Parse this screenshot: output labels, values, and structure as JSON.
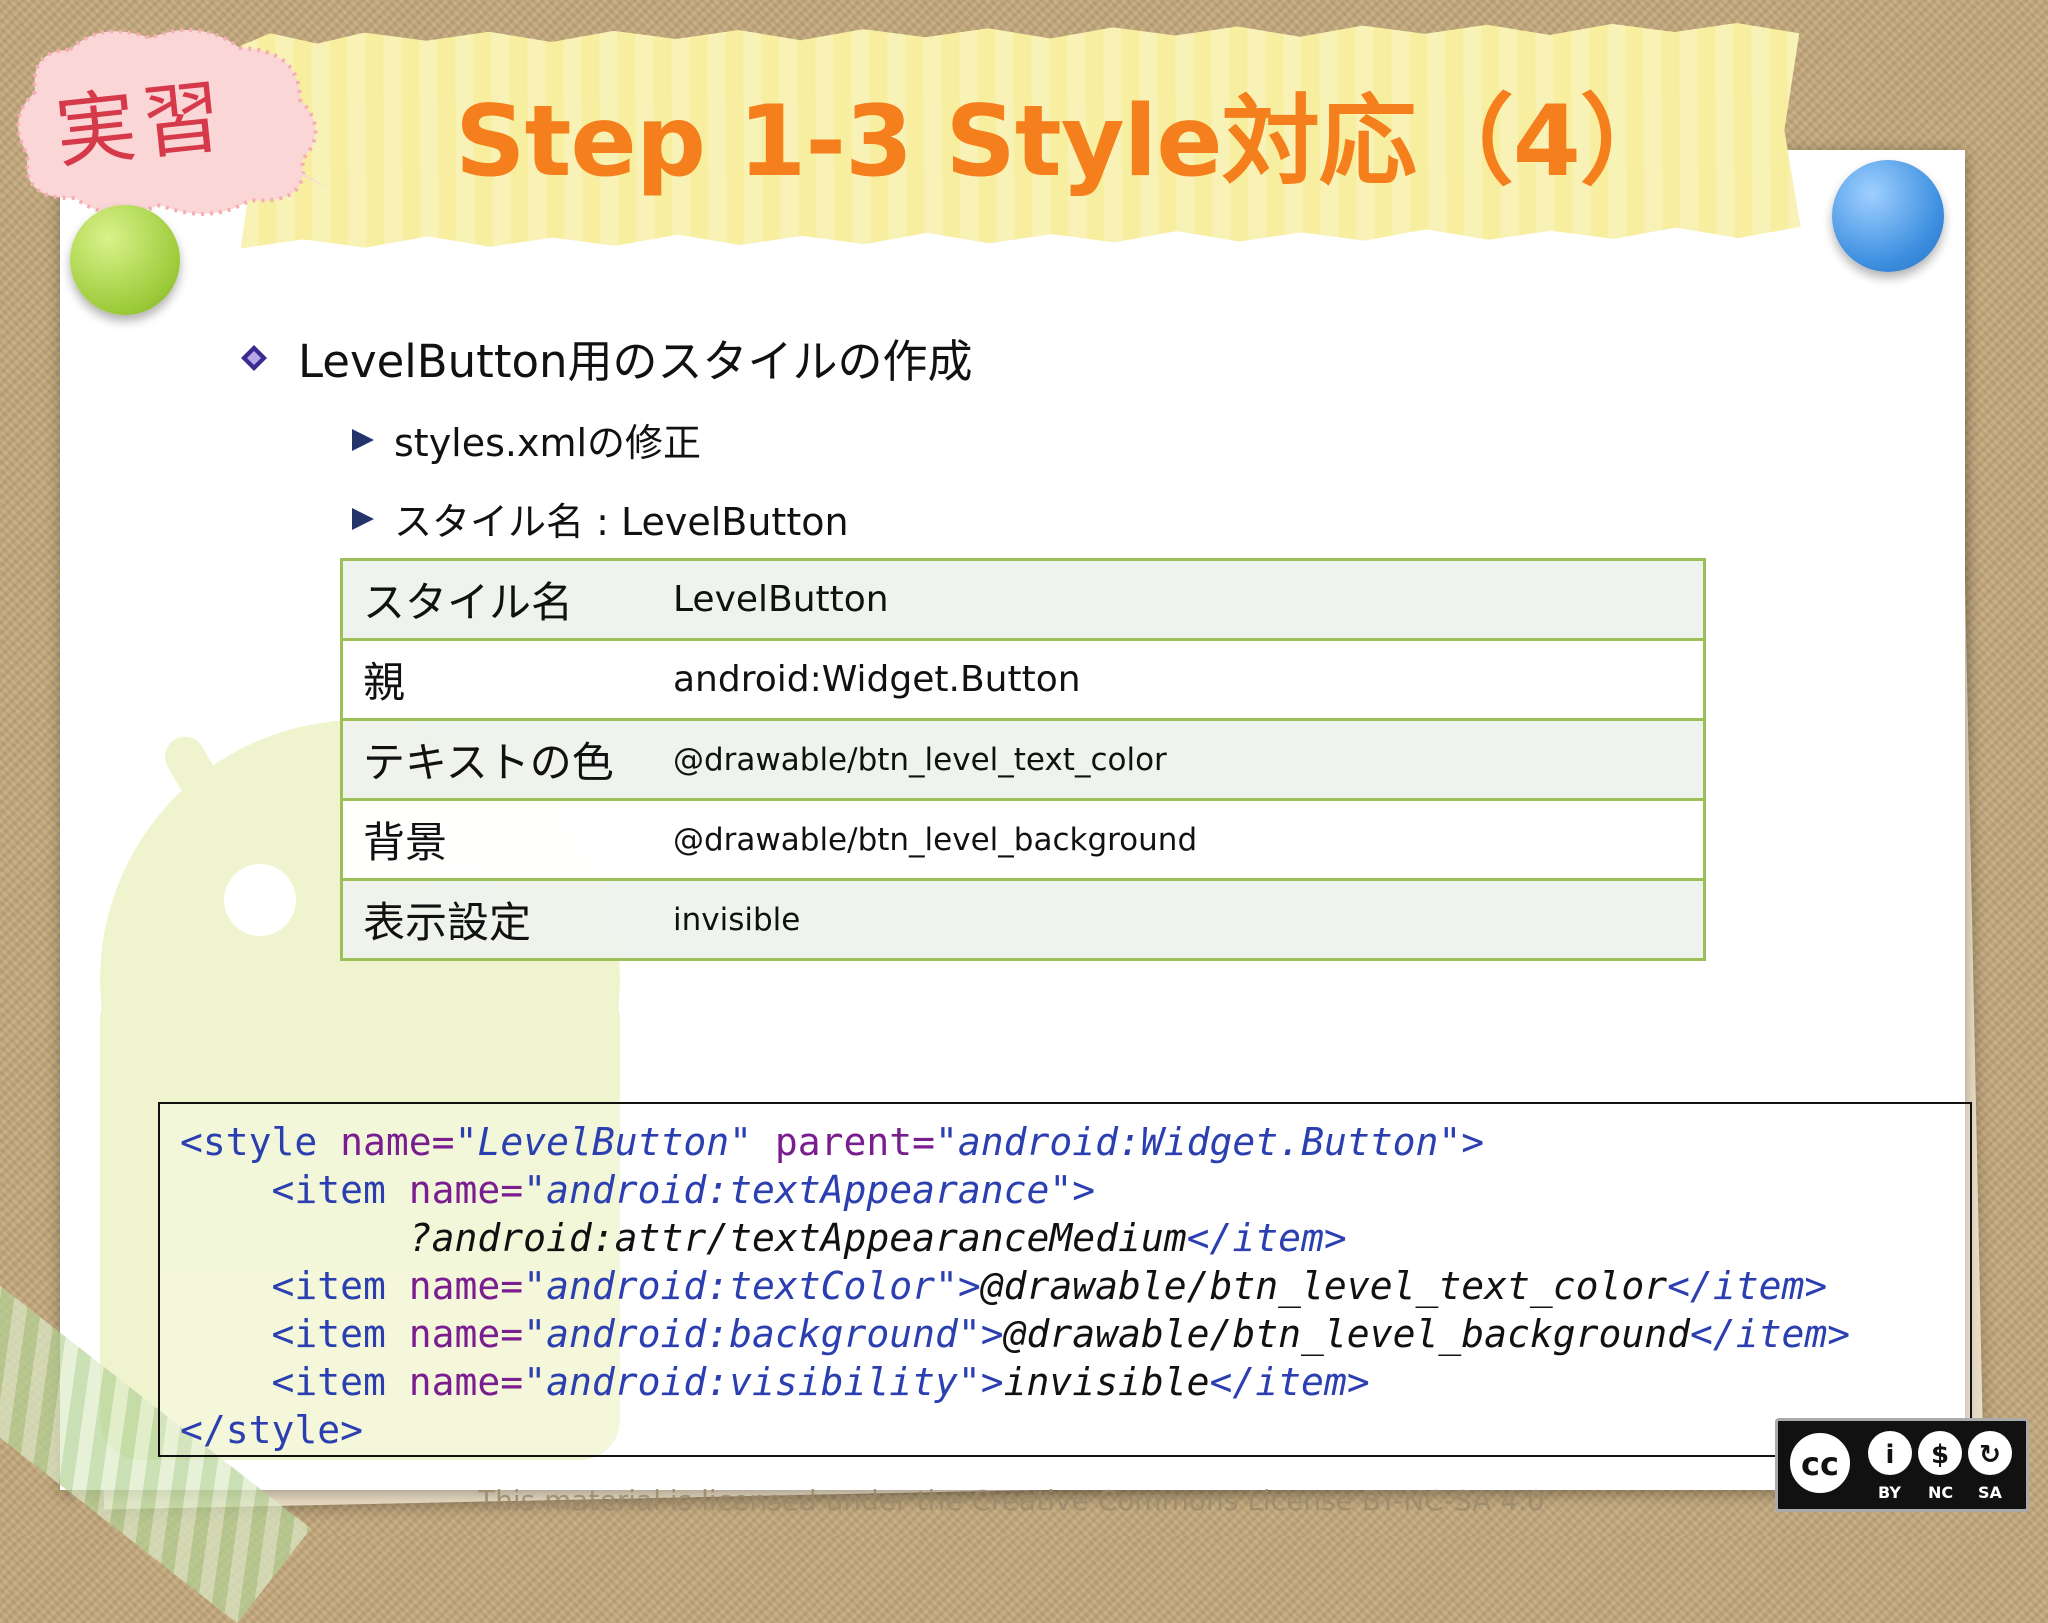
{
  "badge": {
    "label": "実習"
  },
  "title": "Step 1-3 Style対応（4）",
  "bullets": {
    "main": "LevelButton用のスタイルの作成",
    "sub": [
      "styles.xmlの修正",
      "スタイル名 : LevelButton"
    ]
  },
  "table": {
    "rows": [
      {
        "key": "スタイル名",
        "value": "LevelButton"
      },
      {
        "key": "親",
        "value": "android:Widget.Button"
      },
      {
        "key": "テキストの色",
        "value": "@drawable/btn_level_text_color"
      },
      {
        "key": "背景",
        "value": "@drawable/btn_level_background"
      },
      {
        "key": "表示設定",
        "value": "invisible"
      }
    ]
  },
  "code": {
    "line1": {
      "open": "<style",
      "attr1": " name=",
      "val1": "\"LevelButton\"",
      "attr2": " parent=",
      "val2": "\"android:Widget.Button\"",
      "close": ">"
    },
    "line2": {
      "indent": "    ",
      "open": "<item",
      "attr": " name=",
      "val": "\"android:textAppearance\"",
      "close": ">"
    },
    "line3": {
      "indent": "          ",
      "text": "?android:attr/textAppearanceMedium",
      "end": "</item>"
    },
    "line4": {
      "indent": "    ",
      "open": "<item",
      "attr": " name=",
      "val": "\"android:textColor\"",
      "close": ">",
      "text": "@drawable/btn_level_text_color",
      "end": "</item>"
    },
    "line5": {
      "indent": "    ",
      "open": "<item",
      "attr": " name=",
      "val": "\"android:background\"",
      "close": ">",
      "text": "@drawable/btn_level_background",
      "end": "</item>"
    },
    "line6": {
      "indent": "    ",
      "open": "<item",
      "attr": " name=",
      "val": "\"android:visibility\"",
      "close": ">",
      "text": "invisible",
      "end": "</item>"
    },
    "line7": {
      "end": "</style>"
    }
  },
  "license": {
    "text": "This material is licensed under the Creative Commons License BY-NC-SA 4.0",
    "badge": [
      "BY",
      "NC",
      "SA"
    ]
  },
  "colors": {
    "title": "#f47f1c",
    "table_border": "#9cbf58",
    "code_tag": "#2b3fb0",
    "code_attr": "#7a1e8f"
  }
}
